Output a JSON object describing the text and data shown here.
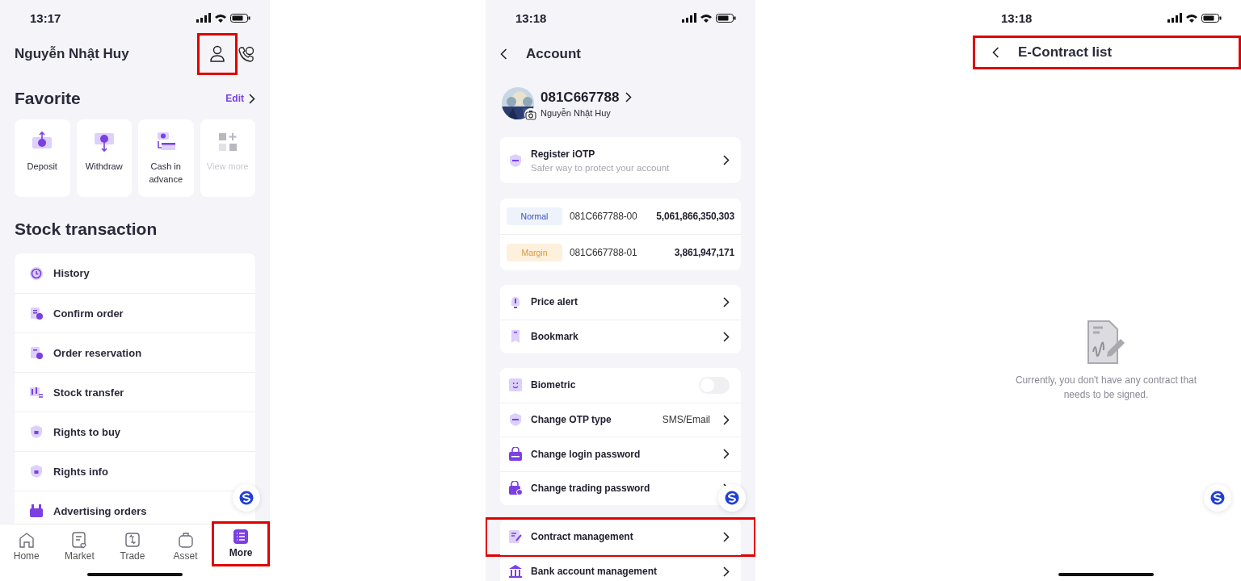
{
  "more_screen": {
    "time": "13:17",
    "user_name": "Nguyễn Nhật Huy",
    "profile_highlighted": true,
    "favorite": {
      "title": "Favorite",
      "edit": "Edit",
      "items": [
        {
          "label": "Deposit",
          "disabled": false
        },
        {
          "label": "Withdraw",
          "disabled": false
        },
        {
          "label": "Cash in advance",
          "disabled": false
        },
        {
          "label": "View more",
          "disabled": true
        }
      ]
    },
    "section_title": "Stock transaction",
    "menu": [
      "History",
      "Confirm order",
      "Order reservation",
      "Stock transfer",
      "Rights to buy",
      "Rights info",
      "Advertising orders"
    ],
    "bottom_nav": [
      {
        "label": "Home",
        "selected": false,
        "highlighted": false
      },
      {
        "label": "Market",
        "selected": false,
        "highlighted": false
      },
      {
        "label": "Trade",
        "selected": false,
        "highlighted": false
      },
      {
        "label": "Asset",
        "selected": false,
        "highlighted": false
      },
      {
        "label": "More",
        "selected": true,
        "highlighted": true
      }
    ]
  },
  "account_screen": {
    "time": "13:18",
    "title": "Account",
    "account_id": "081C667788",
    "user_name": "Nguyễn Nhật Huy",
    "iotp": {
      "title": "Register iOTP",
      "subtitle": "Safer way to protect your account"
    },
    "sub_accounts": [
      {
        "kind": "normal",
        "type": "Normal",
        "number": "081C667788-00",
        "balance": "5,061,866,350,303"
      },
      {
        "kind": "margin",
        "type": "Margin",
        "number": "081C667788-01",
        "balance": "3,861,947,171"
      }
    ],
    "groups": [
      [
        {
          "kind": "link",
          "label": "Price alert",
          "highlighted": false
        },
        {
          "kind": "link",
          "label": "Bookmark",
          "highlighted": false
        }
      ],
      [
        {
          "kind": "toggle",
          "label": "Biometric",
          "on": false,
          "highlighted": false
        },
        {
          "kind": "link",
          "label": "Change OTP type",
          "value": "SMS/Email",
          "highlighted": false
        },
        {
          "kind": "link",
          "label": "Change login password",
          "highlighted": false
        },
        {
          "kind": "link",
          "label": "Change trading password",
          "highlighted": false
        }
      ],
      [
        {
          "kind": "link",
          "label": "Contract management",
          "highlighted": true
        },
        {
          "kind": "link",
          "label": "Bank account management",
          "highlighted": false
        }
      ]
    ]
  },
  "contract_screen": {
    "time": "13:18",
    "title": "E-Contract list",
    "header_highlighted": true,
    "empty_message": "Currently, you don't have any contract that needs to be signed."
  }
}
